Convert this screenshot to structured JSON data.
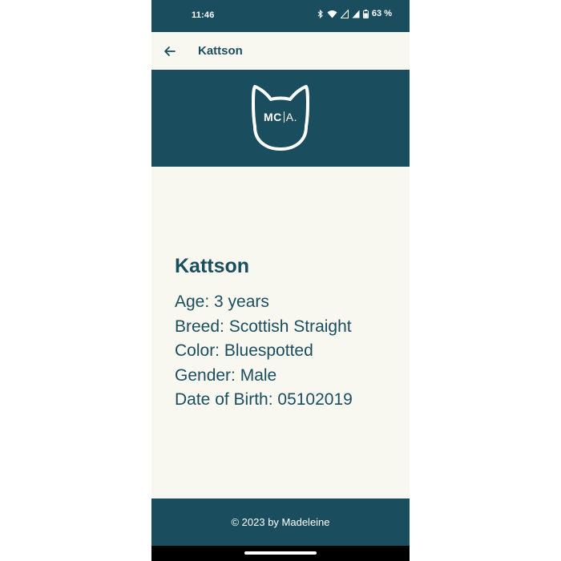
{
  "status_bar": {
    "time": "11:46",
    "battery_percent": "63 %",
    "icons": [
      "bluetooth-icon",
      "wifi-icon",
      "signal-icon",
      "signal-icon-2",
      "battery-icon"
    ]
  },
  "app_bar": {
    "title": "Kattson",
    "back_icon": "arrow-left-icon"
  },
  "banner": {
    "logo_mc": "MC",
    "logo_a": "A."
  },
  "cat": {
    "name": "Kattson",
    "details": [
      "Age: 3 years",
      "Breed: Scottish Straight",
      "Color: Bluespotted",
      "Gender: Male",
      "Date of Birth: 05102019"
    ]
  },
  "footer": {
    "text": "© 2023 by Madeleine"
  },
  "colors": {
    "primary": "#1a4e5f",
    "background": "#f9f8f0",
    "on_primary": "#ffffff"
  }
}
